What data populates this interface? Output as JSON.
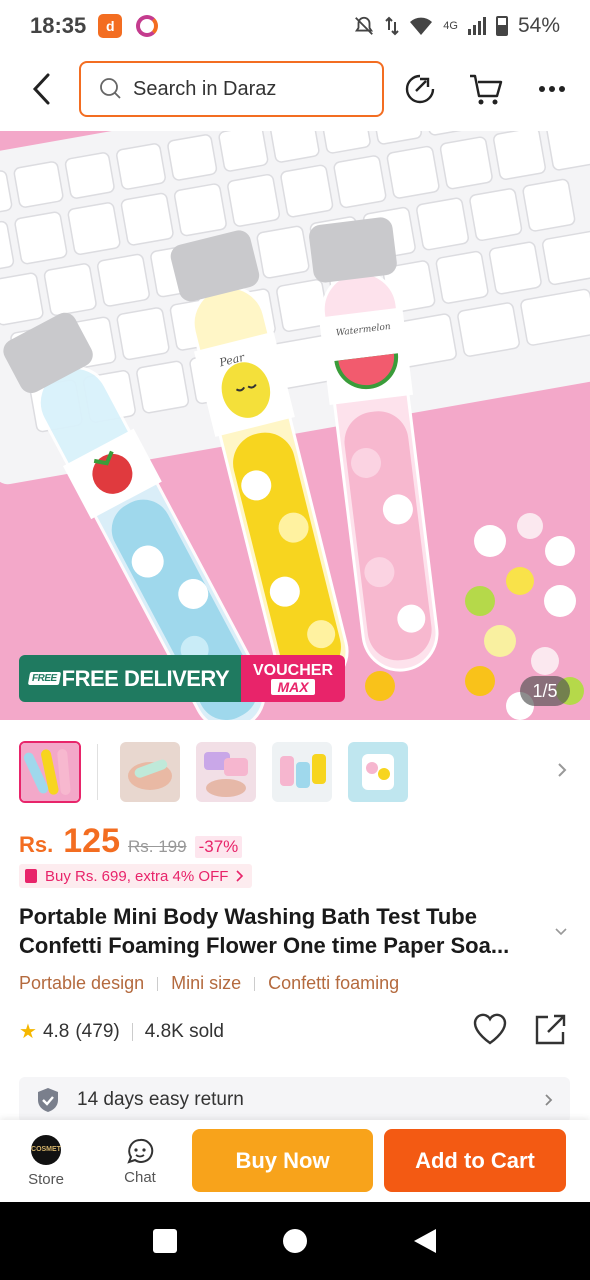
{
  "status_bar": {
    "time": "18:35",
    "network": "4G",
    "battery": "54%"
  },
  "header": {
    "search_placeholder": "Search in Daraz",
    "icons": [
      "back-icon",
      "search-icon",
      "share-icon",
      "cart-icon",
      "more-icon"
    ]
  },
  "gallery": {
    "promo_free": "FREE DELIVERY",
    "promo_free_tag": "FREE",
    "promo_voucher_1": "VOUCHER",
    "promo_voucher_2": "MAX",
    "page_indicator": "1/5",
    "jar_labels": [
      "Pear",
      "Watermelon"
    ]
  },
  "price": {
    "currency": "Rs.",
    "value": "125",
    "original": "Rs. 199",
    "discount": "-37%"
  },
  "promo_chip": "Buy Rs. 699, extra 4% OFF",
  "product": {
    "title": "Portable Mini Body Washing Bath Test Tube Confetti Foaming Flower One time Paper Soa...",
    "tags": [
      "Portable design",
      "Mini size",
      "Confetti foaming"
    ],
    "rating": "4.8",
    "reviews": "(479)",
    "sold": "4.8K sold"
  },
  "return_policy": "14 days easy return",
  "actions": {
    "store": "Store",
    "store_logo_text": "COSMET",
    "chat": "Chat",
    "buy_now": "Buy Now",
    "add_to_cart": "Add to Cart"
  },
  "colors": {
    "brand_orange": "#f36d21",
    "buy_now": "#f8a31b",
    "add_to_cart": "#f35a13",
    "pink_accent": "#e8246a"
  }
}
